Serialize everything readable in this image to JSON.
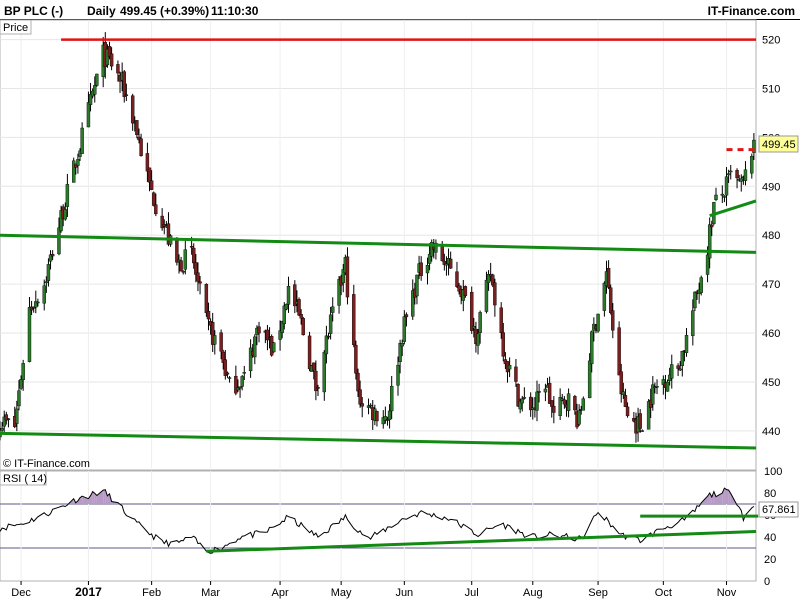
{
  "header": {
    "instrument": "BP PLC (-)",
    "period": "Daily",
    "price_change": "499.45 (+0.39%)",
    "time": "11:10:30",
    "brand": "IT-Finance.com"
  },
  "price_panel": {
    "label": "Price",
    "copyright": "© IT-Finance.com",
    "last_price_label": "499.45"
  },
  "rsi_panel": {
    "label": "RSI ( 14)",
    "last_value_label": "67.861"
  },
  "colors": {
    "bull_candle": "#2a7a2a",
    "bear_candle": "#7a1f1f",
    "wick": "#000000",
    "trendline": "#138a13",
    "resistance": "#e01414",
    "rsi_line": "#000000",
    "rsi_overbought_fill": "#b79ac6",
    "rsi_band": "#5a5a8a",
    "price_marker_bg": "#ffff99"
  },
  "chart_data": [
    {
      "type": "candlestick",
      "title": "BP PLC (-) Daily",
      "ylabel": "Price",
      "ylim": [
        432,
        524
      ],
      "yticks": [
        440,
        450,
        460,
        470,
        480,
        490,
        500,
        510,
        520
      ],
      "x_tick_labels": [
        "Dec",
        "2017",
        "Feb",
        "Mar",
        "Apr",
        "May",
        "Jun",
        "Jul",
        "Aug",
        "Sep",
        "Oct",
        "Nov"
      ],
      "x_range": [
        "2016-11-21",
        "2017-11-15"
      ],
      "x_ticks": [
        "2016-12-01",
        "2017-01-02",
        "2017-02-01",
        "2017-03-01",
        "2017-04-03",
        "2017-05-02",
        "2017-06-01",
        "2017-07-03",
        "2017-08-01",
        "2017-09-01",
        "2017-10-02",
        "2017-11-01"
      ],
      "close_anchors": [
        [
          "2016-11-21",
          442
        ],
        [
          "2016-11-28",
          441
        ],
        [
          "2016-12-05",
          465
        ],
        [
          "2016-12-12",
          470
        ],
        [
          "2016-12-19",
          482
        ],
        [
          "2016-12-27",
          495
        ],
        [
          "2017-01-03",
          507
        ],
        [
          "2017-01-09",
          517
        ],
        [
          "2017-01-13",
          515
        ],
        [
          "2017-01-18",
          511
        ],
        [
          "2017-01-24",
          503
        ],
        [
          "2017-01-31",
          490
        ],
        [
          "2017-02-07",
          482
        ],
        [
          "2017-02-13",
          474
        ],
        [
          "2017-02-20",
          476
        ],
        [
          "2017-02-27",
          462
        ],
        [
          "2017-03-06",
          456
        ],
        [
          "2017-03-10",
          449
        ],
        [
          "2017-03-17",
          451
        ],
        [
          "2017-03-24",
          462
        ],
        [
          "2017-03-31",
          456
        ],
        [
          "2017-04-07",
          469
        ],
        [
          "2017-04-13",
          462
        ],
        [
          "2017-04-20",
          449
        ],
        [
          "2017-04-27",
          462
        ],
        [
          "2017-05-04",
          474
        ],
        [
          "2017-05-10",
          447
        ],
        [
          "2017-05-17",
          444
        ],
        [
          "2017-05-24",
          443
        ],
        [
          "2017-05-31",
          460
        ],
        [
          "2017-06-07",
          471
        ],
        [
          "2017-06-14",
          478
        ],
        [
          "2017-06-21",
          474
        ],
        [
          "2017-06-28",
          469
        ],
        [
          "2017-07-05",
          460
        ],
        [
          "2017-07-12",
          472
        ],
        [
          "2017-07-19",
          455
        ],
        [
          "2017-07-26",
          446
        ],
        [
          "2017-08-02",
          445
        ],
        [
          "2017-08-07",
          450
        ],
        [
          "2017-08-11",
          443
        ],
        [
          "2017-08-17",
          447
        ],
        [
          "2017-08-23",
          442
        ],
        [
          "2017-08-30",
          461
        ],
        [
          "2017-09-05",
          472
        ],
        [
          "2017-09-11",
          450
        ],
        [
          "2017-09-15",
          443
        ],
        [
          "2017-09-21",
          441
        ],
        [
          "2017-09-27",
          448
        ],
        [
          "2017-10-03",
          451
        ],
        [
          "2017-10-09",
          453
        ],
        [
          "2017-10-13",
          459
        ],
        [
          "2017-10-19",
          470
        ],
        [
          "2017-10-23",
          478
        ],
        [
          "2017-10-26",
          486
        ],
        [
          "2017-10-31",
          489
        ],
        [
          "2017-11-03",
          492
        ],
        [
          "2017-11-08",
          490
        ],
        [
          "2017-11-10",
          492
        ],
        [
          "2017-11-14",
          499.45
        ]
      ],
      "reference_lines": [
        {
          "kind": "resistance",
          "style": "solid",
          "y": 520,
          "x_start": "2016-12-20",
          "x_end": "2017-11-15"
        },
        {
          "kind": "upper_channel",
          "style": "solid",
          "points": [
            [
              "2016-11-21",
              480
            ],
            [
              "2017-11-15",
              476.5
            ]
          ]
        },
        {
          "kind": "lower_channel",
          "style": "solid",
          "points": [
            [
              "2016-11-21",
              439.5
            ],
            [
              "2017-11-15",
              436.5
            ]
          ]
        },
        {
          "kind": "short_term_support",
          "style": "solid",
          "points": [
            [
              "2017-10-24",
              484
            ],
            [
              "2017-11-15",
              487
            ]
          ]
        },
        {
          "kind": "breakout_level",
          "style": "dashed",
          "y": 497.5,
          "x_start": "2017-11-01",
          "x_end": "2017-11-15"
        }
      ]
    },
    {
      "type": "line",
      "title": "RSI ( 14)",
      "ylim": [
        0,
        100
      ],
      "yticks": [
        0,
        20,
        40,
        60,
        80,
        100
      ],
      "bands": [
        70,
        30
      ],
      "last_value": 67.861,
      "anchors": [
        [
          "2016-11-21",
          48
        ],
        [
          "2016-12-01",
          52
        ],
        [
          "2016-12-12",
          60
        ],
        [
          "2016-12-27",
          74
        ],
        [
          "2017-01-09",
          82
        ],
        [
          "2017-01-16",
          70
        ],
        [
          "2017-01-23",
          55
        ],
        [
          "2017-02-06",
          35
        ],
        [
          "2017-02-13",
          34
        ],
        [
          "2017-02-20",
          40
        ],
        [
          "2017-02-27",
          27
        ],
        [
          "2017-03-06",
          30
        ],
        [
          "2017-03-15",
          40
        ],
        [
          "2017-03-27",
          44
        ],
        [
          "2017-04-07",
          58
        ],
        [
          "2017-04-21",
          40
        ],
        [
          "2017-05-04",
          58
        ],
        [
          "2017-05-15",
          38
        ],
        [
          "2017-05-31",
          56
        ],
        [
          "2017-06-09",
          62
        ],
        [
          "2017-06-22",
          57
        ],
        [
          "2017-07-06",
          42
        ],
        [
          "2017-07-17",
          52
        ],
        [
          "2017-07-31",
          40
        ],
        [
          "2017-08-11",
          42
        ],
        [
          "2017-08-24",
          38
        ],
        [
          "2017-09-01",
          63
        ],
        [
          "2017-09-12",
          42
        ],
        [
          "2017-09-21",
          37
        ],
        [
          "2017-10-02",
          48
        ],
        [
          "2017-10-13",
          56
        ],
        [
          "2017-10-24",
          78
        ],
        [
          "2017-11-01",
          82
        ],
        [
          "2017-11-07",
          70
        ],
        [
          "2017-11-09",
          58
        ],
        [
          "2017-11-14",
          67.861
        ]
      ],
      "trendlines": [
        {
          "points": [
            [
              "2017-02-27",
              27
            ],
            [
              "2017-11-15",
              45
            ]
          ]
        },
        {
          "points": [
            [
              "2017-09-21",
              59
            ],
            [
              "2017-11-16",
              59
            ]
          ]
        }
      ]
    }
  ]
}
